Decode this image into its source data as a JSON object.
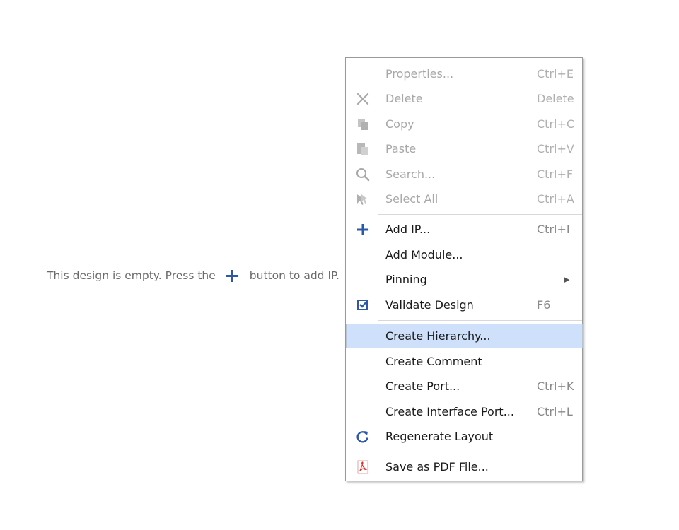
{
  "canvas": {
    "empty_before": "This design is empty. Press the",
    "empty_after": "button to add IP."
  },
  "menu": {
    "items": [
      {
        "label": "Properties...",
        "shortcut": "Ctrl+E",
        "icon": "none",
        "enabled": false
      },
      {
        "label": "Delete",
        "shortcut": "Delete",
        "icon": "x-icon",
        "enabled": false
      },
      {
        "label": "Copy",
        "shortcut": "Ctrl+C",
        "icon": "copy-icon",
        "enabled": false
      },
      {
        "label": "Paste",
        "shortcut": "Ctrl+V",
        "icon": "paste-icon",
        "enabled": false
      },
      {
        "label": "Search...",
        "shortcut": "Ctrl+F",
        "icon": "search-icon",
        "enabled": false
      },
      {
        "label": "Select All",
        "shortcut": "Ctrl+A",
        "icon": "select-all-icon",
        "enabled": false
      },
      {
        "label": "Add IP...",
        "shortcut": "Ctrl+I",
        "icon": "plus-icon",
        "enabled": true
      },
      {
        "label": "Add Module...",
        "shortcut": "",
        "icon": "none",
        "enabled": true
      },
      {
        "label": "Pinning",
        "shortcut": "",
        "icon": "none",
        "enabled": true,
        "submenu": true
      },
      {
        "label": "Validate Design",
        "shortcut": "F6",
        "icon": "checkbox-icon",
        "enabled": true
      },
      {
        "label": "Create Hierarchy...",
        "shortcut": "",
        "icon": "none",
        "enabled": true,
        "highlighted": true
      },
      {
        "label": "Create Comment",
        "shortcut": "",
        "icon": "none",
        "enabled": true
      },
      {
        "label": "Create Port...",
        "shortcut": "Ctrl+K",
        "icon": "none",
        "enabled": true
      },
      {
        "label": "Create Interface Port...",
        "shortcut": "Ctrl+L",
        "icon": "none",
        "enabled": true
      },
      {
        "label": "Regenerate Layout",
        "shortcut": "",
        "icon": "refresh-icon",
        "enabled": true
      },
      {
        "label": "Save as PDF File...",
        "shortcut": "",
        "icon": "pdf-icon",
        "enabled": true
      }
    ],
    "submenu_arrow": "▶"
  },
  "colors": {
    "accent_blue": "#2a5aa6",
    "highlight": "#cfe0fb",
    "disabled_text": "#a8a8a8",
    "pdf_red": "#d9302a"
  }
}
